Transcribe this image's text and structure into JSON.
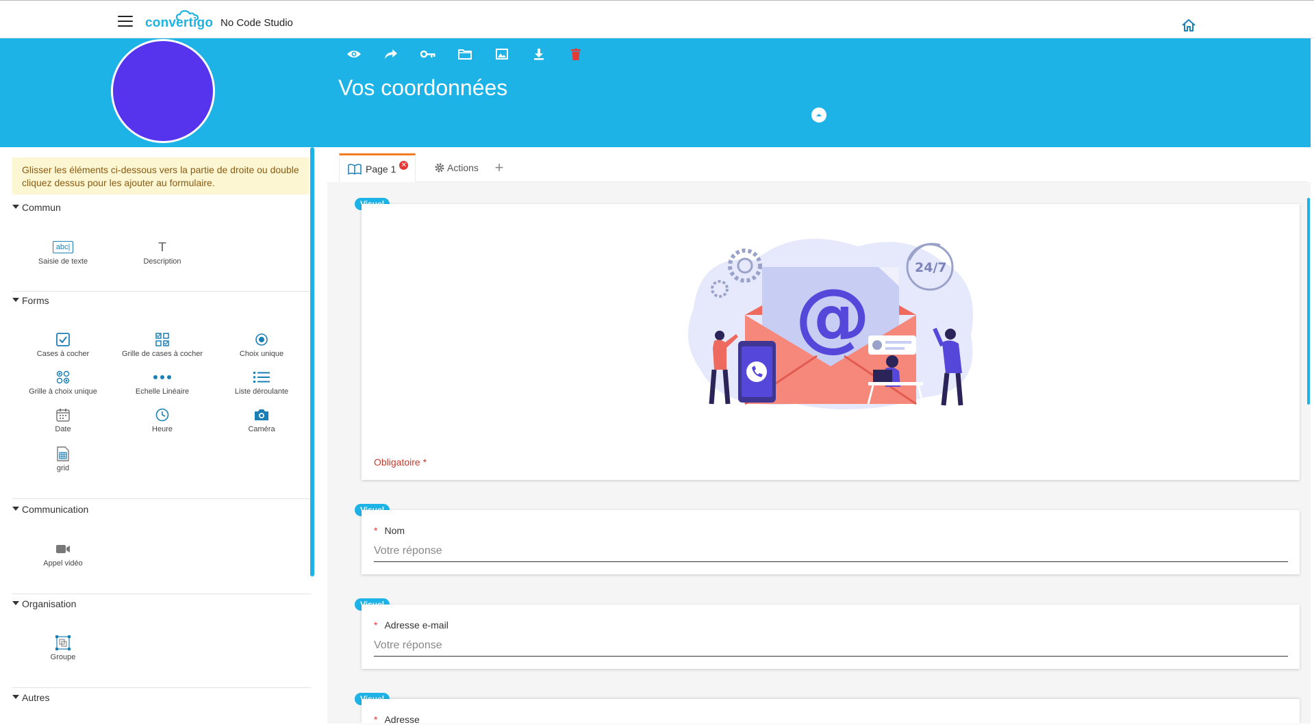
{
  "app": {
    "logo_text": "convertigo",
    "name": "No Code Studio"
  },
  "header": {
    "title": "Vos coordonnées",
    "toolbar": [
      "eye-icon",
      "share-icon",
      "key-icon",
      "folder-icon",
      "image-icon",
      "download-icon",
      "trash-icon"
    ],
    "avatar_color": "#5634ee",
    "accent_color": "#1eb3e6"
  },
  "palette": {
    "hint": "Glisser les éléments ci-dessous vers la partie de droite ou double cliquez dessus pour les ajouter au formulaire.",
    "sections": {
      "commun": {
        "label": "Commun",
        "items": [
          "Saisie de texte",
          "Description"
        ]
      },
      "forms": {
        "label": "Forms",
        "items": [
          "Cases à cocher",
          "Grille de cases à cocher",
          "Choix unique",
          "Grille à choix unique",
          "Echelle Linéaire",
          "Liste déroulante",
          "Date",
          "Heure",
          "Caméra",
          "grid"
        ]
      },
      "communication": {
        "label": "Communication",
        "items": [
          "Appel vidéo"
        ]
      },
      "organisation": {
        "label": "Organisation",
        "items": [
          "Groupe"
        ]
      },
      "autres": {
        "label": "Autres"
      }
    },
    "text_icon_label": "abc|",
    "description_icon_label": "T"
  },
  "tabs": {
    "page": "Page 1",
    "actions": "Actions",
    "add": "+"
  },
  "form": {
    "badge": "Visuel",
    "image_card": {
      "required_text": "Obligatoire *",
      "illustration_text": "24/7"
    },
    "fields": [
      {
        "label": "Nom",
        "placeholder": "Votre réponse"
      },
      {
        "label": "Adresse e-mail",
        "placeholder": "Votre réponse"
      },
      {
        "label": "Adresse"
      }
    ]
  }
}
